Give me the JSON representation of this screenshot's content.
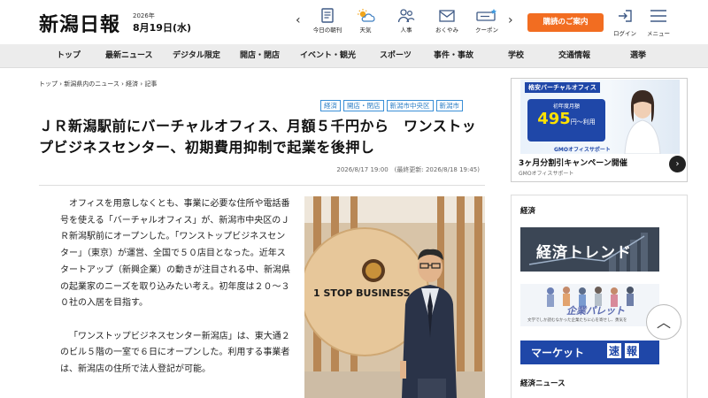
{
  "header": {
    "logo": "新潟日報",
    "date_year": "2026年",
    "date_md": "8月19日(水)",
    "icons": [
      {
        "name": "newspaper-icon",
        "label": "今日の朝刊"
      },
      {
        "name": "weather-icon",
        "label": "天気"
      },
      {
        "name": "people-icon",
        "label": "人事"
      },
      {
        "name": "condolence-icon",
        "label": "おくやみ"
      },
      {
        "name": "coupon-icon",
        "label": "クーポン"
      }
    ],
    "subscribe": "購読のご案内",
    "login": "ログイン",
    "menu": "メニュー"
  },
  "nav": [
    "トップ",
    "最新ニュース",
    "デジタル限定",
    "開店・閉店",
    "イベント・観光",
    "スポーツ",
    "事件・事故",
    "学校",
    "交通情報",
    "選挙"
  ],
  "breadcrumb": "トップ › 新潟県内のニュース › 経済 › 記事",
  "article": {
    "tags": [
      "経済",
      "開店・閉店",
      "新潟市中央区",
      "新潟市"
    ],
    "title": "ＪＲ新潟駅前にバーチャルオフィス、月額５千円から　ワンストップビジネスセンター、初期費用抑制で起業を後押し",
    "timestamp": "2026/8/17 19:00　(最終更新: 2026/8/18 19:45)",
    "paragraphs": [
      "オフィスを用意しなくとも、事業に必要な住所や電話番号を使える「バーチャルオフィス」が、新潟市中央区のＪＲ新潟駅前にオープンした。「ワンストップビジネスセンター」（東京）が運営、全国で５０店目となった。近年スタートアップ（新興企業）の動きが注目される中、新潟県の起業家のニーズを取り込みたい考え。初年度は２０～３０社の入居を目指す。",
      "「ワンストップビジネスセンター新潟店」は、東大通２のビル５階の一室で６日にオープンした。利用する事業者は、新潟店の住所で法人登記が可能。"
    ],
    "photo_sign": "1 STOP BUSINESS"
  },
  "ad": {
    "brand": "格安バーチャルオフィス",
    "badge_caption": "初年度月額",
    "price": "495",
    "price_unit": "円〜利用",
    "gmo": "GMOオフィスサポート",
    "caption": "3ヶ月分割引キャンペーン開催",
    "sub": "GMOオフィスサポート"
  },
  "sidebar": {
    "heading": "経済",
    "trend": "経済トレンド",
    "pallet": "企業パレット",
    "pallet_tagline": "文学でしか読むなかった企業たちに心を寄せし、勇気を",
    "market": "マーケット",
    "market_box1": "速",
    "market_box2": "報",
    "footer": "経済ニュース"
  },
  "scroll_top": "︿"
}
